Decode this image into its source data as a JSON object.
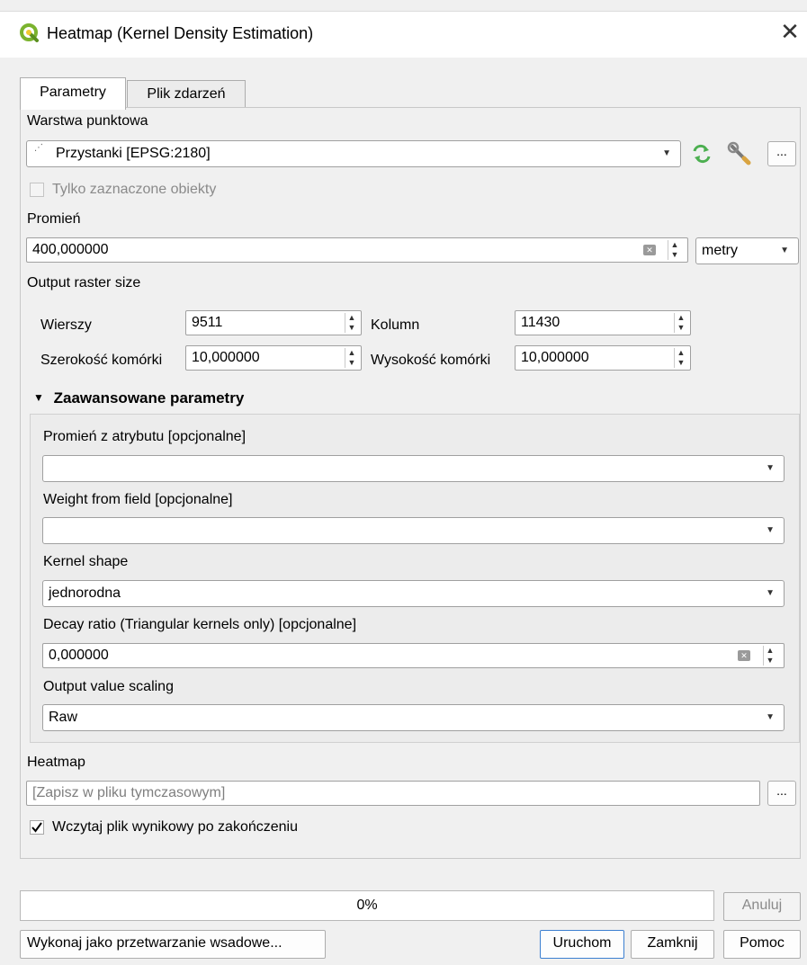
{
  "window": {
    "title": "Heatmap (Kernel Density Estimation)"
  },
  "tabs": [
    {
      "label": "Parametry",
      "active": true
    },
    {
      "label": "Plik zdarzeń",
      "active": false
    }
  ],
  "point_layer": {
    "label": "Warstwa punktowa",
    "value": "Przystanki [EPSG:2180]",
    "selected_only_label": "Tylko zaznaczone obiekty",
    "selected_only_checked": false
  },
  "radius": {
    "label": "Promień",
    "value": "400,000000",
    "unit": "metry"
  },
  "raster_size": {
    "label": "Output raster size",
    "rows_label": "Wierszy",
    "rows_value": "9511",
    "cols_label": "Kolumn",
    "cols_value": "11430",
    "cell_w_label": "Szerokość komórki",
    "cell_w_value": "10,000000",
    "cell_h_label": "Wysokość komórki",
    "cell_h_value": "10,000000"
  },
  "advanced": {
    "header": "Zaawansowane parametry",
    "radius_field_label": "Promień z atrybutu [opcjonalne]",
    "radius_field_value": "",
    "weight_field_label": "Weight from field [opcjonalne]",
    "weight_field_value": "",
    "kernel_shape_label": "Kernel shape",
    "kernel_shape_value": "jednorodna",
    "decay_label": "Decay ratio (Triangular kernels only) [opcjonalne]",
    "decay_value": "0,000000",
    "scaling_label": "Output value scaling",
    "scaling_value": "Raw"
  },
  "output": {
    "label": "Heatmap",
    "placeholder": "[Zapisz w pliku tymczasowym]",
    "load_label": "Wczytaj plik wynikowy po zakończeniu",
    "load_checked": true
  },
  "progress": {
    "text": "0%",
    "fraction": 0
  },
  "buttons": {
    "cancel": "Anuluj",
    "batch": "Wykonaj jako przetwarzanie wsadowe...",
    "run": "Uruchom",
    "close": "Zamknij",
    "help": "Pomoc",
    "dots": "..."
  },
  "icons": {
    "app": "qgis-icon",
    "refresh": "iterate-icon",
    "settings": "wrench-icon",
    "close": "close-icon"
  },
  "colors": {
    "qgis_green": "#7bb32e",
    "focus_blue": "#3c7fd0",
    "iterate_green": "#4caf50"
  }
}
